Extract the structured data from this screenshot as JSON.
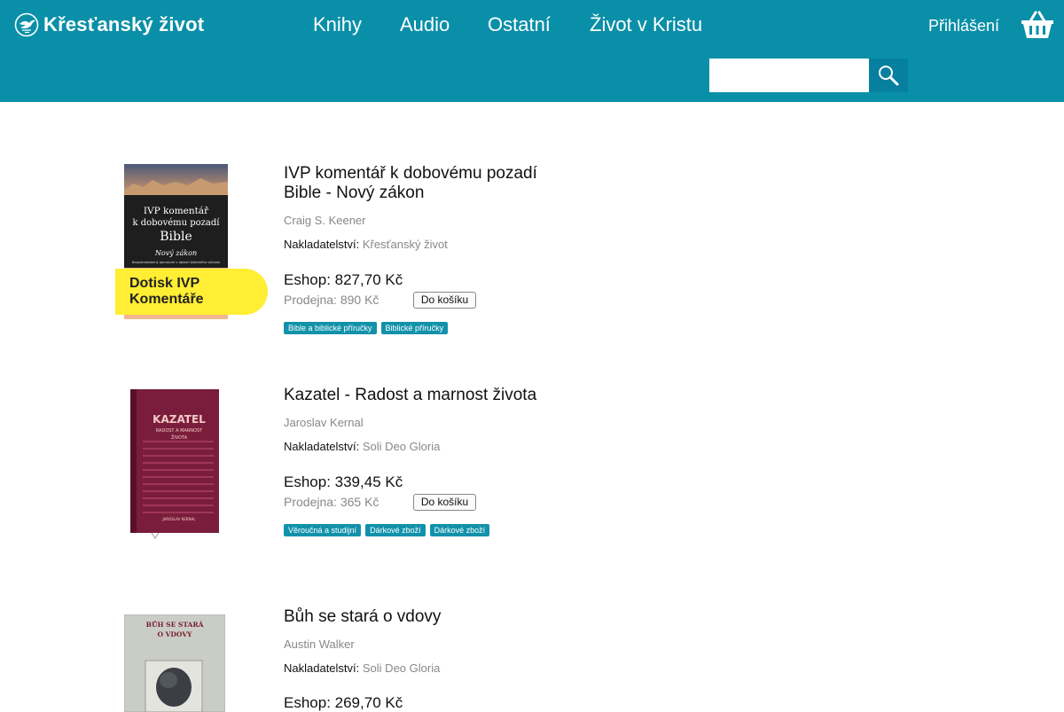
{
  "header": {
    "brand": "Křesťanský život",
    "nav": [
      "Knihy",
      "Audio",
      "Ostatní",
      "Život v Kristu"
    ],
    "login": "Přihlášení",
    "search_placeholder": "",
    "icons": {
      "logo": "dove-logo-icon",
      "cart": "basket-icon",
      "search": "search-icon"
    }
  },
  "products": [
    {
      "title": "IVP komentář k dobovému pozadí Bible - Nový zákon",
      "author": "Craig S. Keener",
      "publisher_label": "Nakladatelství:",
      "publisher": "Křesťanský život",
      "eshop_price": "Eshop: 827,70 Kč",
      "store_price": "Prodejna: 890 Kč",
      "cart_button": "Do košíku",
      "ribbon": "Dotisk IVP Komentáře",
      "tags": [
        "Bible a biblické příručky",
        "Biblické příručky"
      ],
      "cover": {
        "line1": "IVP komentář",
        "line2": "k dobovému pozadí",
        "line3": "Bible",
        "line4": "Nový zákon",
        "line5": "Nepostradatelný pomocník v oblasti biblického výkladu"
      }
    },
    {
      "title": "Kazatel - Radost a marnost života",
      "author": "Jaroslav Kernal",
      "publisher_label": "Nakladatelství:",
      "publisher": "Soli Deo Gloria",
      "eshop_price": "Eshop: 339,45 Kč",
      "store_price": "Prodejna: 365 Kč",
      "cart_button": "Do košíku",
      "tags": [
        "Věroučná a studijní",
        "Dárkové zboží",
        "Dárkové zboží"
      ],
      "cover": {
        "line1": "KAZATEL",
        "line2": "RADOST A MARNOST",
        "line3": "ŽIVOTA",
        "line4": "JAROSLAV KERNAL"
      }
    },
    {
      "title": "Bůh se stará o vdovy",
      "author": "Austin Walker",
      "publisher_label": "Nakladatelství:",
      "publisher": "Soli Deo Gloria",
      "eshop_price": "Eshop: 269,70 Kč",
      "cover": {
        "line1": "BŮH SE STARÁ",
        "line2": "O VDOVY"
      }
    }
  ]
}
